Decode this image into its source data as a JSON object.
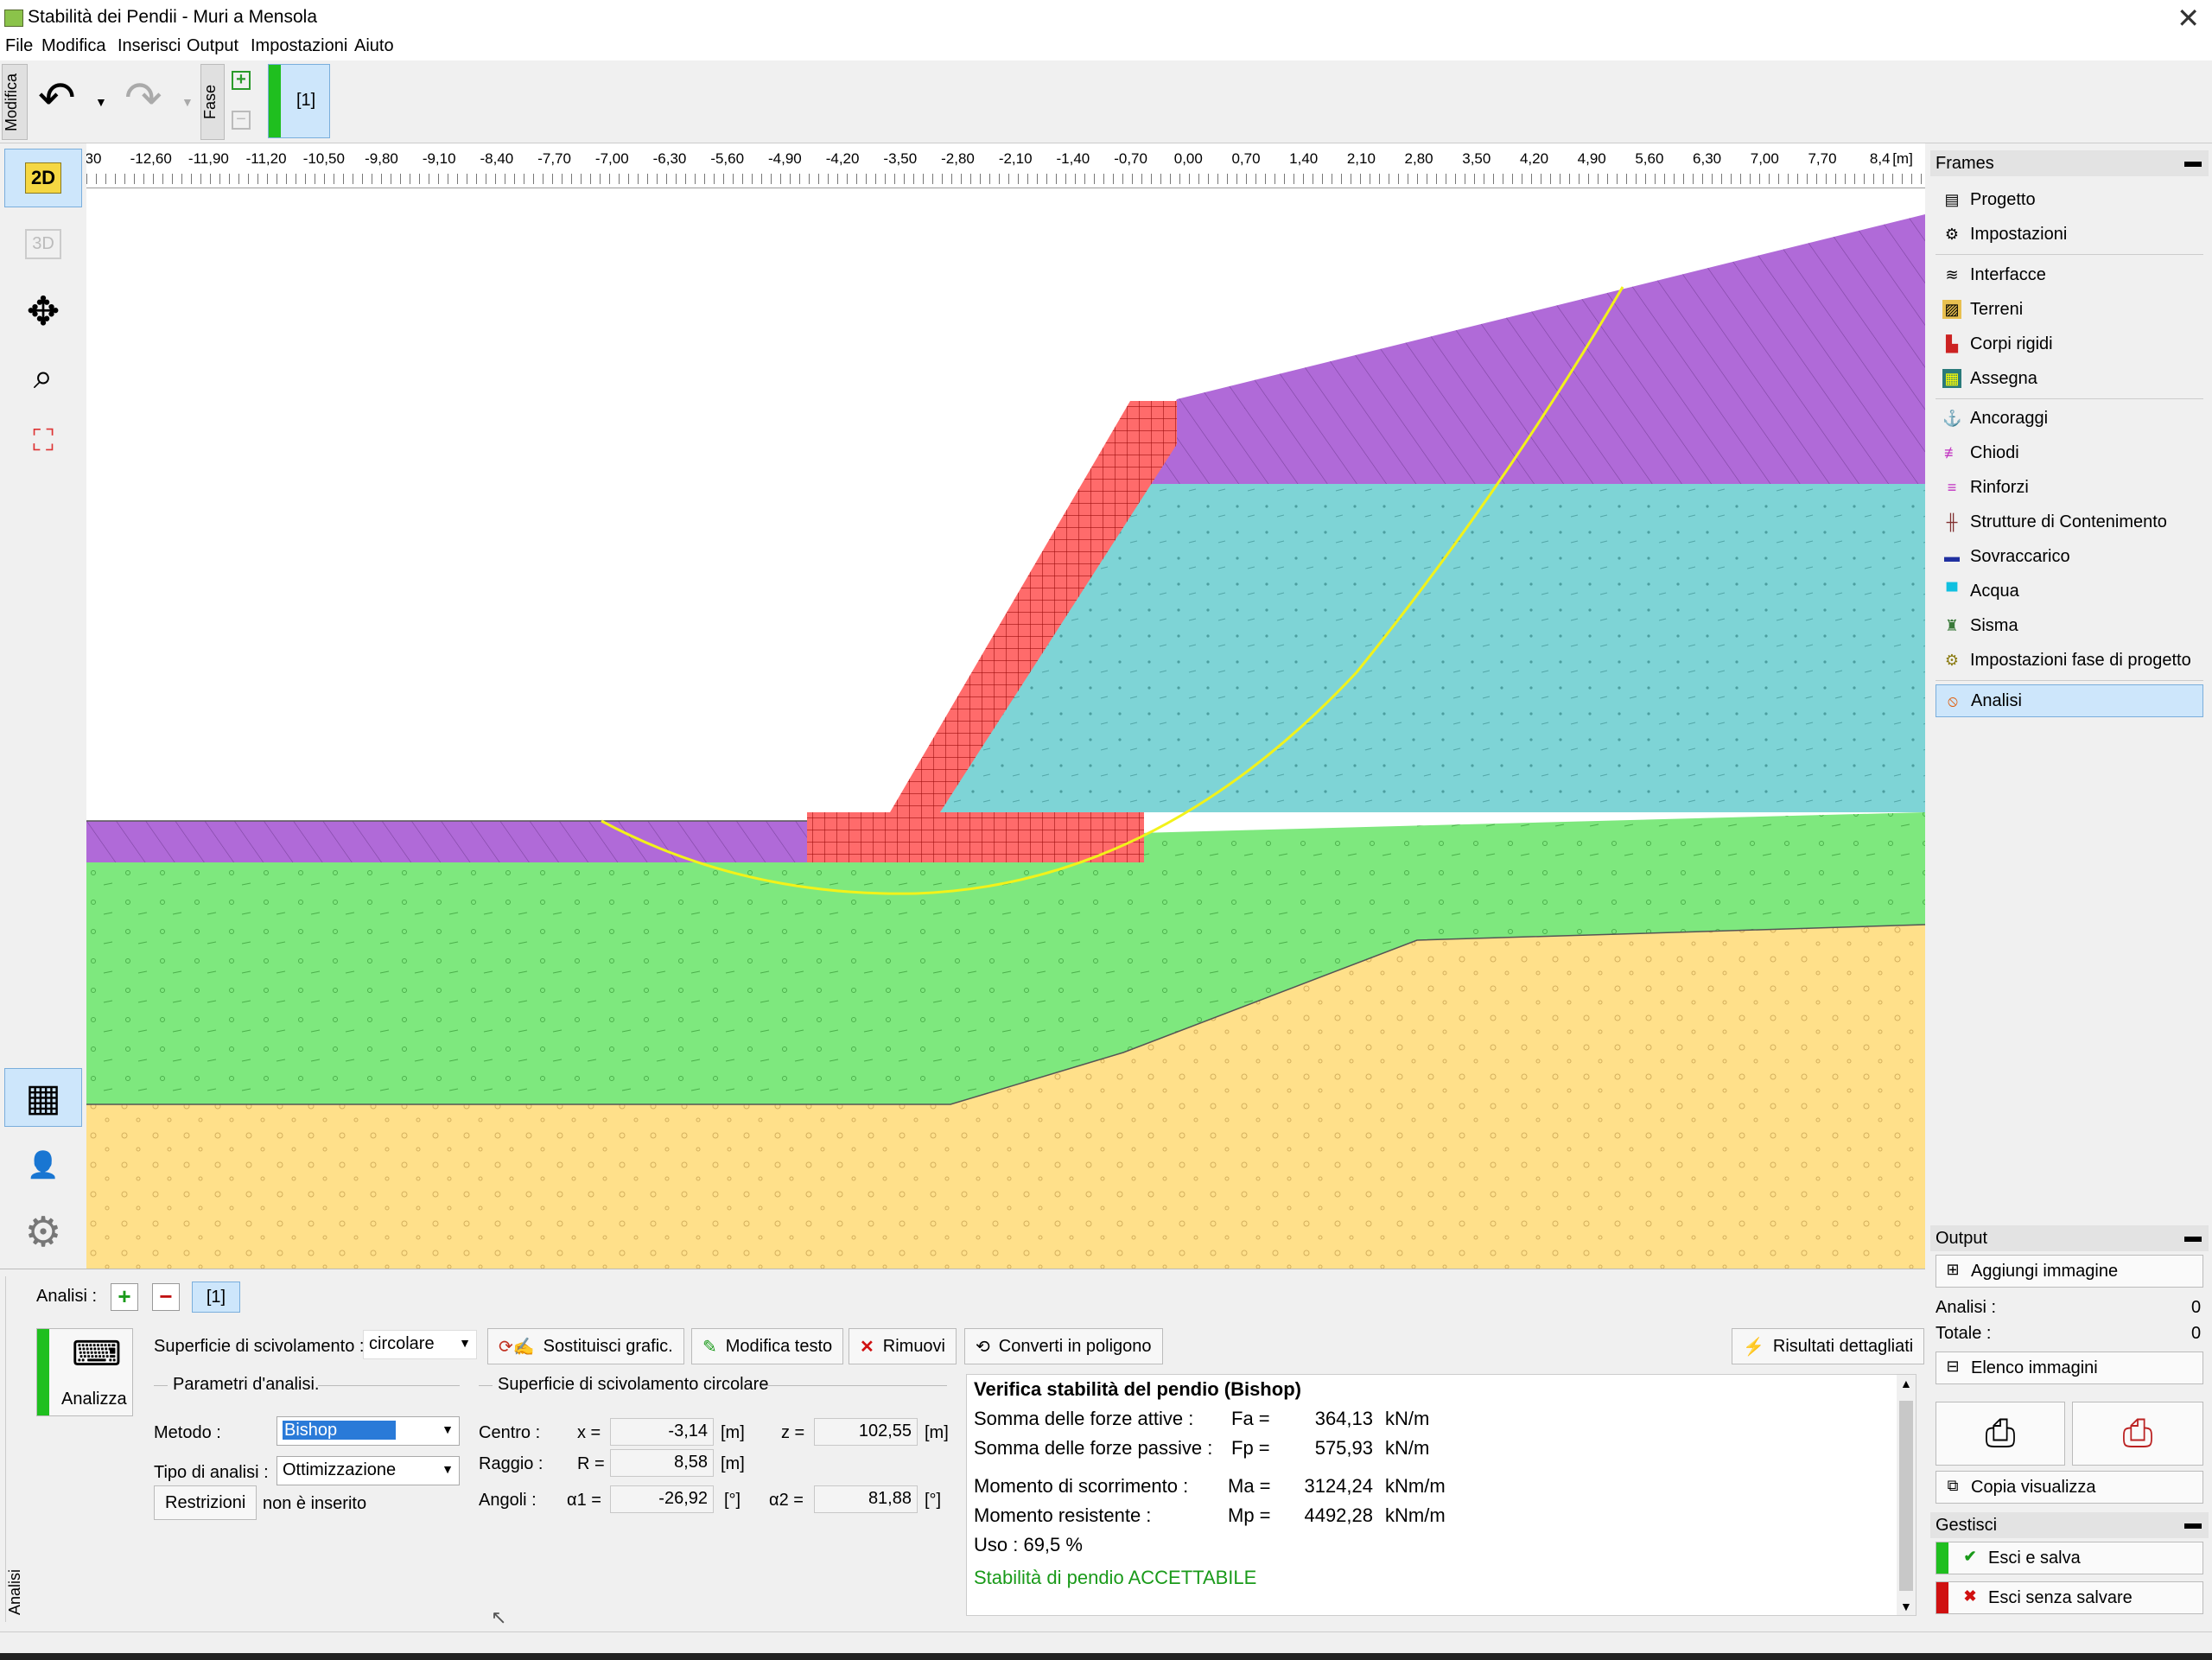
{
  "window": {
    "title": "Stabilità dei Pendii  - Muri a Mensola"
  },
  "menu": [
    "File",
    "Modifica",
    "Inserisci",
    "Output",
    "Impostazioni",
    "Aiuto"
  ],
  "toolbar": {
    "mode_tab": "Modifica",
    "stage_tab": "Fase",
    "stage_label": "[1]"
  },
  "ruler": {
    "unit": "[m]",
    "ticks": [
      "30",
      "-12,60",
      "-11,90",
      "-11,20",
      "-10,50",
      "-9,80",
      "-9,10",
      "-8,40",
      "-7,70",
      "-7,00",
      "-6,30",
      "-5,60",
      "-4,90",
      "-4,20",
      "-3,50",
      "-2,80",
      "-2,10",
      "-1,40",
      "-0,70",
      "0,00",
      "0,70",
      "1,40",
      "2,10",
      "2,80",
      "3,50",
      "4,20",
      "4,90",
      "5,60",
      "6,30",
      "7,00",
      "7,70",
      "8,4"
    ]
  },
  "left_tools": {
    "btn_2d": "2D",
    "btn_3d": "3D"
  },
  "frames": {
    "header": "Frames",
    "items": [
      {
        "label": "Progetto",
        "icon": "document-icon"
      },
      {
        "label": "Impostazioni",
        "icon": "gear-icon"
      },
      {
        "label": "Interfacce",
        "icon": "interfaces-icon"
      },
      {
        "label": "Terreni",
        "icon": "soil-icon"
      },
      {
        "label": "Corpi rigidi",
        "icon": "rigid-body-icon"
      },
      {
        "label": "Assegna",
        "icon": "assign-icon"
      },
      {
        "label": "Ancoraggi",
        "icon": "anchor-icon"
      },
      {
        "label": "Chiodi",
        "icon": "nail-icon"
      },
      {
        "label": "Rinforzi",
        "icon": "reinforcement-icon"
      },
      {
        "label": "Strutture di Contenimento",
        "icon": "retaining-structure-icon"
      },
      {
        "label": "Sovraccarico",
        "icon": "surcharge-icon"
      },
      {
        "label": "Acqua",
        "icon": "water-icon"
      },
      {
        "label": "Sisma",
        "icon": "earthquake-icon"
      },
      {
        "label": "Impostazioni fase di progetto",
        "icon": "stage-settings-icon"
      },
      {
        "label": "Analisi",
        "icon": "analysis-icon"
      }
    ]
  },
  "output": {
    "header": "Output",
    "add_image": "Aggiungi immagine",
    "analisi_label": "Analisi :",
    "analisi_value": "0",
    "totale_label": "Totale :",
    "totale_value": "0",
    "image_list": "Elenco immagini",
    "copy_view": "Copia  visualizza"
  },
  "gestisci": {
    "header": "Gestisci",
    "exit_save": "Esci e salva",
    "exit_nosave": "Esci senza salvare"
  },
  "analysis_panel": {
    "side_tab": "Analisi",
    "label": "Analisi :",
    "stage": "[1]",
    "run": "Analizza",
    "surface_label": "Superficie di scivolamento :",
    "surface_value": "circolare",
    "btn_replace": "Sostituisci grafic.",
    "btn_edit_text": "Modifica testo",
    "btn_remove": "Rimuovi",
    "btn_convert": "Converti in poligono",
    "btn_details": "Risultati dettagliati",
    "params_title": "Parametri d'analisi.",
    "metodo_label": "Metodo  :",
    "metodo_value": "Bishop",
    "tipo_label": "Tipo di analisi  :",
    "tipo_value": "Ottimizzazione",
    "restr_btn": "Restrizioni",
    "restr_value": "non è inserito",
    "circ_title": "Superficie di scivolamento circolare",
    "centro_label": "Centro  :",
    "x_label": "x =",
    "x_value": "-3,14",
    "x_unit": "[m]",
    "z_label": "z =",
    "z_value": "102,55",
    "z_unit": "[m]",
    "raggio_label": "Raggio  :",
    "r_label": "R =",
    "r_value": "8,58",
    "r_unit": "[m]",
    "angoli_label": "Angoli  :",
    "a1_label": "α1 =",
    "a1_value": "-26,92",
    "a1_unit": "[°]",
    "a2_label": "α2 =",
    "a2_value": "81,88",
    "a2_unit": "[°]"
  },
  "results": {
    "title": "Verifica stabilità del pendio (Bishop)",
    "active_label": "Somma delle forze attive :",
    "fa_label": "Fa =",
    "fa_value": "364,13",
    "fa_unit": "kN/m",
    "passive_label": "Somma delle forze passive :",
    "fp_label": "Fp =",
    "fp_value": "575,93",
    "fp_unit": "kN/m",
    "sliding_label": "Momento di scorrimento :",
    "ma_label": "Ma =",
    "ma_value": "3124,24",
    "ma_unit": "kNm/m",
    "resisting_label": "Momento resistente :",
    "mp_label": "Mp =",
    "mp_value": "4492,28",
    "mp_unit": "kNm/m",
    "usage": "Uso :  69,5  %",
    "verdict": "Stabilità di pendio ACCETTABILE",
    "verdict_color": "#1a9a1a"
  },
  "colors": {
    "purple": "#b06ad8",
    "cyan": "#7ed4d6",
    "green": "#7ee87e",
    "yellow": "#ffe08a",
    "wall": "#ff6b6b",
    "slip": "#f2f21a"
  }
}
